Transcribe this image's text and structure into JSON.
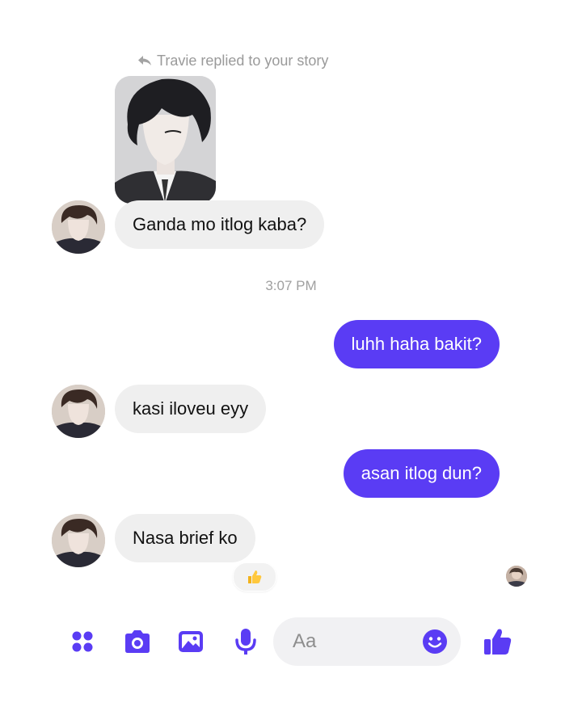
{
  "reply_note": "Travie replied to your story",
  "messages": [
    {
      "from": "them",
      "text": "Ganda mo itlog kaba?"
    },
    {
      "from": "me",
      "text": "luhh haha bakit?"
    },
    {
      "from": "them",
      "text": "kasi iloveu eyy"
    },
    {
      "from": "me",
      "text": "asan itlog dun?"
    },
    {
      "from": "them",
      "text": "Nasa brief ko"
    }
  ],
  "timestamp": "3:07 PM",
  "reaction_icon": "thumbs-up",
  "composer": {
    "placeholder": "Aa",
    "icons": [
      "apps-icon",
      "camera-icon",
      "gallery-icon",
      "microphone-icon",
      "emoji-icon",
      "thumbs-up-icon"
    ]
  },
  "colors": {
    "accent": "#5a3cf4",
    "incoming_bubble": "#efefef",
    "muted_text": "#9a9a9a"
  }
}
